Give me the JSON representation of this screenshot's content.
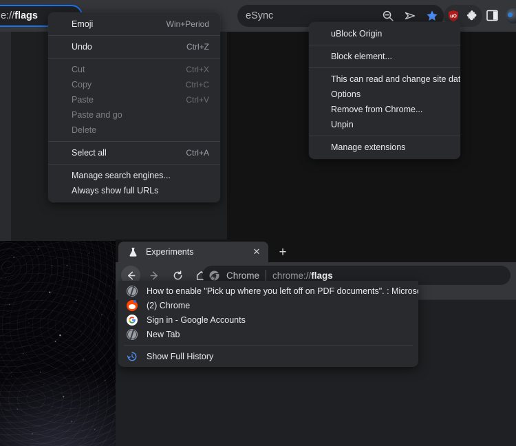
{
  "top_window": {
    "omnibox_left": {
      "url_prefix": "rome://",
      "url_bold": "flags",
      "focus_color": "#1a73e8"
    },
    "omnibox_right": {
      "suggestion_text": "eSync"
    },
    "toolbar_icons": [
      {
        "name": "zoom-out-icon",
        "label": "Zoom out"
      },
      {
        "name": "share-icon",
        "label": "Share this page"
      },
      {
        "name": "bookmark-star-icon",
        "label": "Bookmark this tab",
        "color": "#4d8df6"
      },
      {
        "name": "ublock-origin-icon",
        "label": "uBlock Origin",
        "color": "#b11b1b"
      },
      {
        "name": "extensions-puzzle-icon",
        "label": "Extensions"
      },
      {
        "name": "side-panel-icon",
        "label": "Show side panel"
      },
      {
        "name": "profile-avatar",
        "label": "Profile"
      }
    ]
  },
  "omnibox_context_menu": {
    "items": [
      {
        "label": "Emoji",
        "accel": "Win+Period",
        "disabled": false,
        "sep_after": true
      },
      {
        "label": "Undo",
        "accel": "Ctrl+Z",
        "disabled": false,
        "sep_after": true
      },
      {
        "label": "Cut",
        "accel": "Ctrl+X",
        "disabled": true
      },
      {
        "label": "Copy",
        "accel": "Ctrl+C",
        "disabled": true
      },
      {
        "label": "Paste",
        "accel": "Ctrl+V",
        "disabled": true
      },
      {
        "label": "Paste and go",
        "accel": "",
        "disabled": true
      },
      {
        "label": "Delete",
        "accel": "",
        "disabled": true,
        "sep_after": true
      },
      {
        "label": "Select all",
        "accel": "Ctrl+A",
        "disabled": false,
        "sep_after": true
      },
      {
        "label": "Manage search engines...",
        "accel": "",
        "disabled": false
      },
      {
        "label": "Always show full URLs",
        "accel": "",
        "disabled": false
      }
    ]
  },
  "extension_context_menu": {
    "items": [
      {
        "label": "uBlock Origin",
        "submenu": false,
        "sep_after": true
      },
      {
        "label": "Block element...",
        "submenu": false,
        "sep_after": true
      },
      {
        "label": "This can read and change site data",
        "submenu": true
      },
      {
        "label": "Options",
        "submenu": false
      },
      {
        "label": "Remove from Chrome...",
        "submenu": false
      },
      {
        "label": "Unpin",
        "submenu": false,
        "sep_after": true
      },
      {
        "label": "Manage extensions",
        "submenu": false
      }
    ],
    "submenu_arrow": "▶"
  },
  "bottom_window": {
    "tab": {
      "title": "Experiments",
      "favicon": "flask-icon",
      "close_glyph": "✕"
    },
    "new_tab_glyph": "+",
    "nav": {
      "back_glyph": "←",
      "forward_glyph": "→",
      "reload_glyph": "⟳",
      "home_glyph": "⌂"
    },
    "omnibox": {
      "chip_label": "Chrome",
      "url_prefix": "chrome://",
      "url_bold": "flags"
    },
    "history_dropdown": {
      "items": [
        {
          "icon": "globe-icon",
          "label": "How to enable \"Pick up where you left off on PDF documents\". : MicrosoftEdge"
        },
        {
          "icon": "reddit-icon",
          "label": "(2) Chrome"
        },
        {
          "icon": "google-icon",
          "label": "Sign in - Google Accounts"
        },
        {
          "icon": "globe-icon",
          "label": "New Tab"
        }
      ],
      "footer": {
        "icon": "history-clock-icon",
        "label": "Show Full History"
      }
    }
  }
}
